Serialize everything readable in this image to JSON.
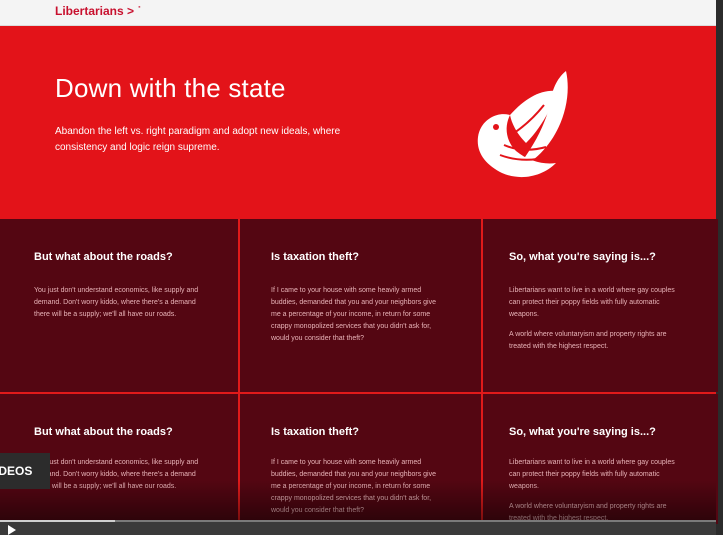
{
  "header": {
    "brand": "Libertarians > ˙"
  },
  "hero": {
    "title": "Down with the state",
    "subtitle": "Abandon the left vs. right paradigm and adopt new ideals, where consistency and logic reign supreme."
  },
  "cards": [
    {
      "title": "But what about the roads?",
      "body": [
        "You just don't understand economics, like supply and demand. Don't worry kiddo, where there's a demand there will be a supply; we'll all have our roads."
      ]
    },
    {
      "title": "Is taxation theft?",
      "body": [
        "If I came to your house with some heavily armed buddies, demanded that you and your neighbors give me a percentage of your income, in return for some crappy monopolized services that you didn't ask for, would you consider that theft?"
      ]
    },
    {
      "title": "So, what you're saying is...?",
      "body": [
        "Libertarians want to live in a world where gay couples can protect their poppy fields with fully automatic weapons.",
        "A world where voluntaryism and property rights are treated with the highest respect."
      ]
    },
    {
      "title": "But what about the roads?",
      "body": [
        "You just don't understand economics, like supply and demand. Don't worry kiddo, where there's a demand there will be a supply; we'll all have our roads."
      ]
    },
    {
      "title": "Is taxation theft?",
      "body": [
        "If I came to your house with some heavily armed buddies, demanded that you and your neighbors give me a percentage of your income, in return for some crappy monopolized services that you didn't ask for, would you consider that theft?"
      ]
    },
    {
      "title": "So, what you're saying is...?",
      "body": [
        "Libertarians want to live in a world where gay couples can protect their poppy fields with fully automatic weapons.",
        "A world where voluntaryism and property rights are treated with the highest respect."
      ]
    }
  ],
  "overlay": {
    "videos_label": "IDEOS"
  },
  "player": {
    "progress_fraction": 0.16
  },
  "colors": {
    "accent": "#e31319",
    "card_bg": "#540612",
    "brand_text": "#c8102e"
  },
  "icons": {
    "logo": "porcupine-bird-logo-icon",
    "play": "play-icon"
  }
}
